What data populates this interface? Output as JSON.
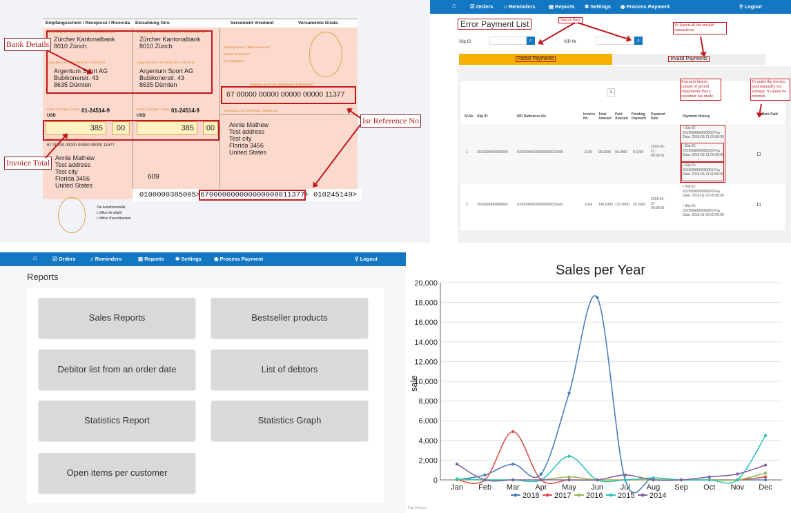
{
  "slip": {
    "header": {
      "receipt": "Empfangsschein / Récépissé / Ricevuta",
      "deposit": "Einzahlung Giro",
      "transfer": "Versement Virement",
      "versamento": "Versamento Girata"
    },
    "bank_name": "Zürcher Kantonalbank",
    "bank_city": "8010 Zürich",
    "payee_name": "Argentum Sport AG",
    "payee_street": "Bubikonerstr. 43",
    "payee_city": "8635 Dürnten",
    "account": "01-24514-9",
    "currency": "USD",
    "amount_francs": "385",
    "amount_cents": "00",
    "ref_small": "67 00000 00000 00000 00000 11577",
    "isr_ref": "67 00000 00000 00000 00000 11377",
    "payer_name": "Annie Mathew",
    "payer_address": "Test address",
    "payer_city": "Test city",
    "payer_state": "Florida 3456",
    "payer_country": "United States",
    "slip_number": "609",
    "office_1": "Die Annahmestelle",
    "office_2": "L'office de dépôt",
    "office_3": "L'ufficio d'accettazione",
    "codeline_a": "0100000385005>",
    "codeline_b": "670000000000000000011377",
    "codeline_c": "+ 010245149>",
    "callouts": {
      "bank_details": "Bank Details",
      "invoice_total": "Invoice Total",
      "isr_reference": "Isr Reference No"
    }
  },
  "nav": {
    "home_icon": "home-icon",
    "orders": "Orders",
    "reminders": "Reminders",
    "reports": "Reports",
    "settings": "Settings",
    "process_payment": "Process Payment",
    "logout": "Logout"
  },
  "error_list": {
    "title": "Error Payment List",
    "search_bars_note": "Search Bars",
    "list_out_note": "To listout all the invalid transactions",
    "slip_id_label": "Slip ID",
    "isr_label": "ISR Nr",
    "tab_partial": "Partial Payments",
    "tab_invalid": "Invalid Payments",
    "page": "1",
    "history_note": "Payment history consist of period ofpayments that a customer has made.",
    "mark_note": "To make the invoice paid manually via webapp. It cannot be reverted",
    "columns": [
      "Sl.No",
      "Slip ID",
      "ISR Reference No",
      "Invoice No",
      "Total Amount",
      "Paid Amount",
      "Pending Payment",
      "Payment Date",
      "Payment History",
      "Mark Paid"
    ],
    "rows": [
      {
        "sl": "1",
        "slip": "2019999900000000",
        "isr": "670000000000000000001695",
        "invoice": "1169",
        "total": "99.6200",
        "paid": "90.0000",
        "pending": "9.6200",
        "date": "2018-06-21 00:00:00",
        "history": [
          "Slip ID: 2019999900000000 Pay Date: 2018-06-21 00:00:00",
          "Slip ID: 2019999900000000 Pay Date: 2018-06-21 00:00:00",
          "Slip ID: 2019999900000001 Pay Date: 2018-06-21 00:00:00"
        ]
      },
      {
        "sl": "2",
        "slip": "2019999999999900",
        "isr": "670000000000000000001642",
        "invoice": "1164",
        "total": "196.5300",
        "paid": "170.0000",
        "pending": "26.5300",
        "date": "2018-01-07 00:00:00",
        "history": [
          "Slip ID: 2019999999999900 Pay Date: 2018-01-07 00:00:00",
          "Slip ID: 2019999999999900 Pay Date: 2018-01-09 00:00:00"
        ]
      }
    ]
  },
  "reports": {
    "title": "Reports",
    "buttons": [
      "Sales Reports",
      "Bestseller products",
      "Debitor list from an order date",
      "List of debtors",
      "Statistics Report",
      "Statistics Graph",
      "Open items per customer"
    ]
  },
  "trial_text": "Trial Version",
  "chart_data": {
    "type": "line",
    "title": "Sales per Year",
    "xlabel": "",
    "ylabel": "sale",
    "ylim": [
      0,
      20000
    ],
    "yticks": [
      "0",
      "2,000",
      "4,000",
      "6,000",
      "8,000",
      "10,000",
      "12,000",
      "14,000",
      "16,000",
      "18,000",
      "20,000"
    ],
    "categories": [
      "Jan",
      "Feb",
      "Mar",
      "Apr",
      "May",
      "Jun",
      "Jul",
      "Aug",
      "Sep",
      "Oct",
      "Nov",
      "Dec"
    ],
    "legend_position": "bottom",
    "series": [
      {
        "name": "2018",
        "color": "#4a7ebb",
        "values": [
          0,
          500,
          1600,
          600,
          8800,
          18500,
          0,
          200,
          0,
          0,
          0,
          0
        ]
      },
      {
        "name": "2017",
        "color": "#d9534f",
        "values": [
          0,
          0,
          4900,
          0,
          0,
          0,
          0,
          0,
          0,
          0,
          0,
          300
        ]
      },
      {
        "name": "2016",
        "color": "#9bbb59",
        "values": [
          0,
          0,
          0,
          0,
          300,
          0,
          0,
          0,
          0,
          0,
          0,
          700
        ]
      },
      {
        "name": "2015",
        "color": "#2ec4b6",
        "values": [
          100,
          0,
          0,
          0,
          2400,
          0,
          0,
          200,
          0,
          0,
          0,
          4500
        ]
      },
      {
        "name": "2014",
        "color": "#8064a2",
        "values": [
          1600,
          0,
          0,
          0,
          0,
          0,
          500,
          0,
          0,
          300,
          600,
          1500
        ]
      }
    ]
  }
}
